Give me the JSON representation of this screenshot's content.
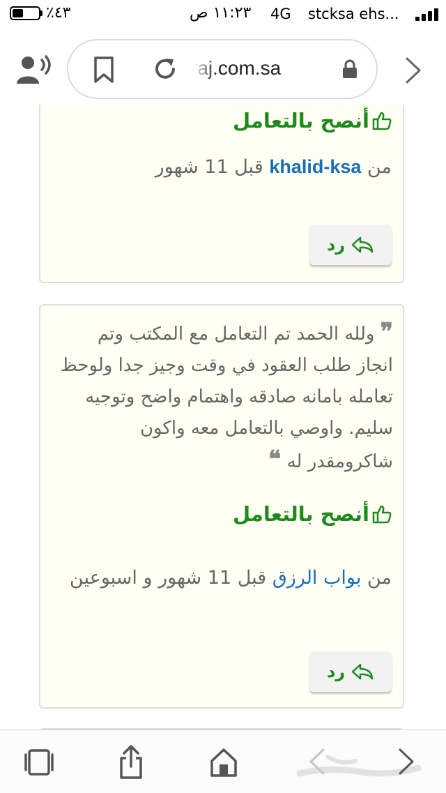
{
  "status_bar": {
    "battery_percent": "٪٤٣",
    "battery_level": 0.43,
    "time": "١١:٢٣ ص",
    "network": "4G",
    "carrier": "stcksa ehs..."
  },
  "browser": {
    "url": "raj.com.sa"
  },
  "cards": [
    {
      "recommend_label": "أنصح بالتعامل",
      "byline_prefix": "من",
      "username": "khalid-ksa",
      "time_ago": "قبل 11 شهور",
      "reply_label": "رد"
    },
    {
      "review_text": "ولله الحمد تم التعامل مع المكتب وتم انجاز طلب العقود في وقت وجيز جدا ولوحظ تعامله بامانه صادقه واهتمام واضح وتوجيه سليم. واوصي بالتعامل معه واكون شاكرومقدر له",
      "recommend_label": "أنصح بالتعامل",
      "byline_prefix": "من",
      "username": "بواب الرزق",
      "time_ago": "قبل 11 شهور و اسبوعين",
      "reply_label": "رد"
    }
  ],
  "colors": {
    "recommend_green": "#1e8a1e",
    "user_link_blue": "#1a6db5",
    "card_background": "#fffff4"
  },
  "icons": {
    "speak": "speaker-person-icon",
    "bookmark": "bookmark-icon",
    "reload": "reload-icon",
    "lock": "lock-icon",
    "forward": "chevron-right-icon",
    "thumb": "thumbs-up-icon",
    "reply": "reply-arrow-icon",
    "tabs": "tabs-icon",
    "share": "share-icon",
    "home": "home-icon",
    "back": "chevron-left-icon",
    "forward_bottom": "chevron-right-icon"
  }
}
